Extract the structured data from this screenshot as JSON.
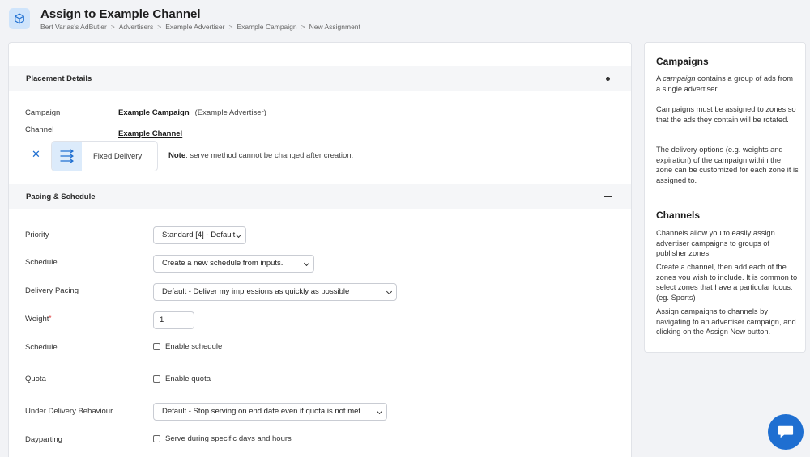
{
  "header": {
    "title": "Assign to Example Channel",
    "breadcrumb": [
      "Bert Varias's AdButler",
      "Advertisers",
      "Example Advertiser",
      "Example Campaign",
      "New Assignment"
    ],
    "separator": ">"
  },
  "placement": {
    "section_title": "Placement Details",
    "campaign_label": "Campaign",
    "campaign_link": "Example Campaign",
    "campaign_advertiser": "(Example Advertiser)",
    "channel_label": "Channel",
    "channel_link": "Example Channel",
    "close_glyph": "✕",
    "delivery_method": "Fixed Delivery",
    "note_bold": "Note",
    "note_text": ": serve method cannot be changed after creation."
  },
  "pacing": {
    "section_title": "Pacing & Schedule",
    "priority_label": "Priority",
    "priority_value": "Standard [4] - Default",
    "schedule_label": "Schedule",
    "schedule_value": "Create a new schedule from inputs.",
    "delivery_pacing_label": "Delivery Pacing",
    "delivery_pacing_value": "Default - Deliver my impressions as quickly as possible",
    "weight_label": "Weight",
    "weight_required": "*",
    "weight_value": "1",
    "schedule2_label": "Schedule",
    "enable_schedule": "Enable schedule",
    "quota_label": "Quota",
    "enable_quota": "Enable quota",
    "under_delivery_label": "Under Delivery Behaviour",
    "under_delivery_value": "Default - Stop serving on end date even if quota is not met",
    "dayparting_label": "Dayparting",
    "dayparting_option": "Serve during specific days and hours"
  },
  "sidebar": {
    "campaigns_title": "Campaigns",
    "campaigns_p1_a": "A ",
    "campaigns_p1_em": "campaign",
    "campaigns_p1_b": " contains a group of ads from a single advertiser.",
    "campaigns_p2": "Campaigns must be assigned to zones so that the ads they contain will be rotated.",
    "campaigns_p3": "The delivery options (e.g. weights and expiration) of the campaign within the zone can be customized for each zone it is assigned to.",
    "channels_title": "Channels",
    "channels_p1": "Channels allow you to easily assign advertiser campaigns to groups of publisher zones.",
    "channels_p2": "Create a channel, then add each of the zones you wish to include. It is common to select zones that have a particular focus. (eg. Sports)",
    "channels_p3": "Assign campaigns to channels by navigating to an advertiser campaign, and clicking on the Assign New button."
  },
  "colors": {
    "accent": "#1f6fd1",
    "icon_bg": "#cfe4fb"
  },
  "icons": {
    "app": "cube-icon",
    "delivery": "fixed-delivery-arrows-icon",
    "chat": "chat-bubble-icon"
  }
}
